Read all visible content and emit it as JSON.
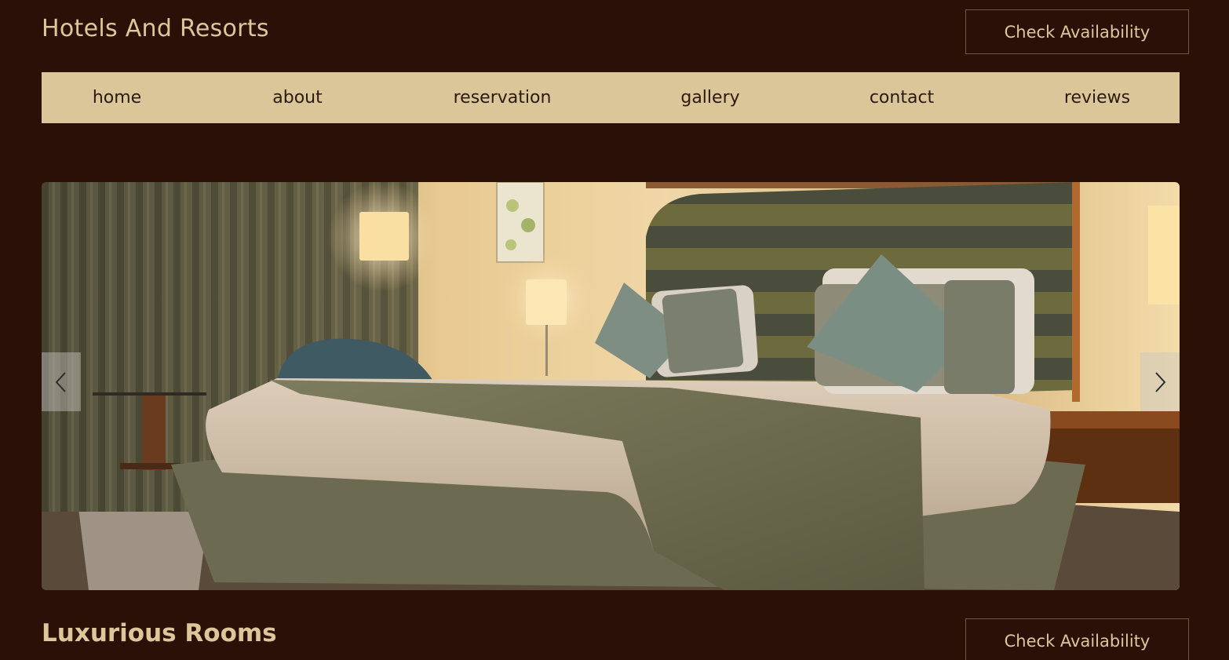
{
  "header": {
    "site_title": "Hotels And Resorts",
    "cta_label": "Check Availability"
  },
  "nav": {
    "items": [
      {
        "label": "home"
      },
      {
        "label": "about"
      },
      {
        "label": "reservation"
      },
      {
        "label": "gallery"
      },
      {
        "label": "contact"
      },
      {
        "label": "reviews"
      }
    ]
  },
  "carousel": {
    "slide_description_icon": "hotel-room-photo",
    "prev_icon": "chevron-left-icon",
    "next_icon": "chevron-right-icon"
  },
  "section": {
    "heading": "Luxurious Rooms",
    "cta_label": "Check Availability"
  },
  "colors": {
    "background": "#2a1006",
    "accent": "#ddc69a",
    "nav_background": "#dbc69a",
    "nav_text": "#2c1a0d"
  }
}
